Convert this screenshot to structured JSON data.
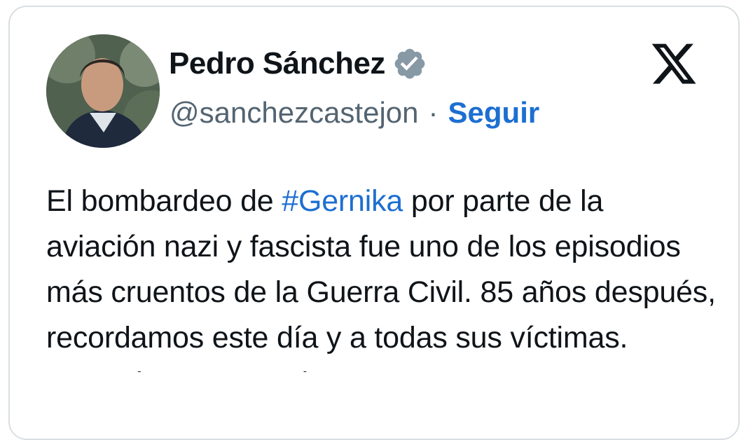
{
  "author": {
    "display_name": "Pedro Sánchez",
    "handle": "@sanchezcastejon",
    "separator": "·",
    "follow_label": "Seguir",
    "verified_icon": "verified-badge-icon"
  },
  "brand": {
    "logo_icon": "x-logo-icon"
  },
  "tweet": {
    "text_before": "El bombardeo de ",
    "hashtag": "#Gernika",
    "text_after": " por parte de la aviación nazi y fascista fue uno de los episodios más cruentos de la Guerra Civil. 85 años después, recordamos este día y a todas sus víctimas. Recordar nos permite"
  },
  "colors": {
    "accent": "#1d6fd1",
    "text": "#0f1419",
    "muted": "#536471",
    "badge": "#8899a6",
    "border": "#d9dee2"
  }
}
